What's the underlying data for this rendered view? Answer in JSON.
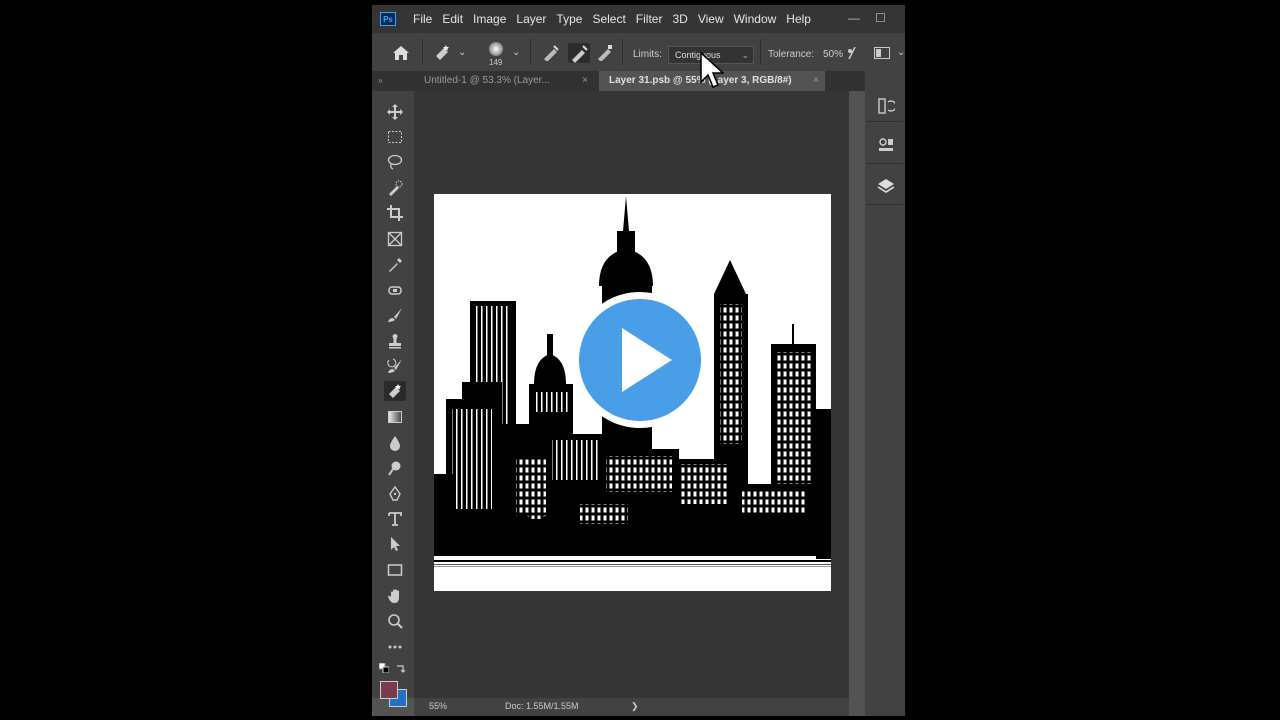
{
  "app": {
    "logo_text": "Ps",
    "menu": [
      "File",
      "Edit",
      "Image",
      "Layer",
      "Type",
      "Select",
      "Filter",
      "3D",
      "View",
      "Window",
      "Help"
    ],
    "window_controls": {
      "minimize": "—",
      "maximize": "☐"
    }
  },
  "options": {
    "brush_size": "149",
    "limits_label": "Limits:",
    "limits_value": "Contiguous",
    "tolerance_label": "Tolerance:",
    "tolerance_value": "50%"
  },
  "tabs": [
    {
      "label": "Untitled-1 @ 53.3% (Layer...",
      "close": "×",
      "active": false
    },
    {
      "label": "Layer 31.psb @ 55% (Layer 3, RGB/8#)",
      "close": "×",
      "active": true
    }
  ],
  "tabs_collapse_left": "»",
  "tabs_collapse_right": "«",
  "tools": [
    "move-icon",
    "marquee-icon",
    "lasso-icon",
    "quick-select-icon",
    "crop-icon",
    "frame-icon",
    "eyedropper-icon",
    "healing-icon",
    "brush-icon",
    "stamp-icon",
    "history-brush-icon",
    "eraser-icon",
    "gradient-icon",
    "blur-icon",
    "dodge-icon",
    "pen-icon",
    "type-icon",
    "path-select-icon",
    "rectangle-icon",
    "hand-icon",
    "zoom-icon",
    "more-icon"
  ],
  "colors": {
    "foreground": "#7a3b4c",
    "background": "#1e73c8",
    "play_button": "#4a9ee8"
  },
  "status": {
    "zoom": "55%",
    "doc": "Doc: 1.55M/1.55M",
    "arrow": "❯"
  },
  "right_panel": [
    "history-icon",
    "properties-icon",
    "layers-icon"
  ]
}
